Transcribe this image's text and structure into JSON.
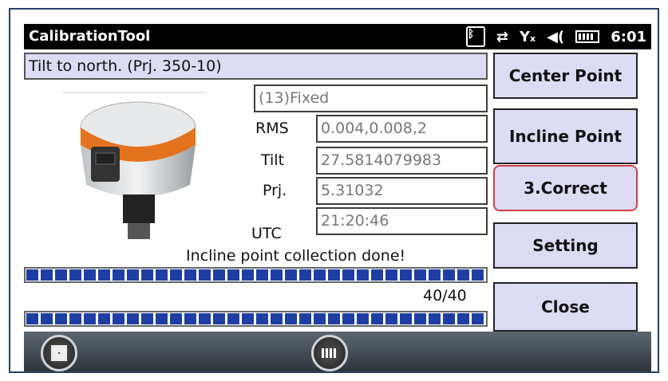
{
  "window": {
    "app_title": "CalibrationTool",
    "time": "6:01"
  },
  "status_icons": [
    "bluetooth-icon",
    "sync-icon",
    "no-signal-icon",
    "volume-icon",
    "battery-icon"
  ],
  "task_label": "Tilt to north. (Prj. 350-10)",
  "fix_status": "(13)Fixed",
  "fields": {
    "rms": {
      "label": "RMS",
      "value": "0.004,0.008,2"
    },
    "tilt": {
      "label": "Tilt",
      "value": "27.5814079983"
    },
    "prj": {
      "label": "Prj.",
      "value": "5.31032"
    },
    "utc": {
      "label": "UTC",
      "value": "21:20:46"
    }
  },
  "message": "Incline point collection done!",
  "progress": {
    "fraction": 1.0,
    "count_label": "40/40"
  },
  "second_progress": {
    "fraction": 1.0
  },
  "buttons": {
    "center_point": "Center Point",
    "incline_point": "Incline Point",
    "correct": "3.Correct",
    "setting": "Setting",
    "close": "Close"
  },
  "colors": {
    "accent": "#dcdcf5",
    "progress": "#1f3ea3",
    "selected_border": "#d0404a"
  }
}
